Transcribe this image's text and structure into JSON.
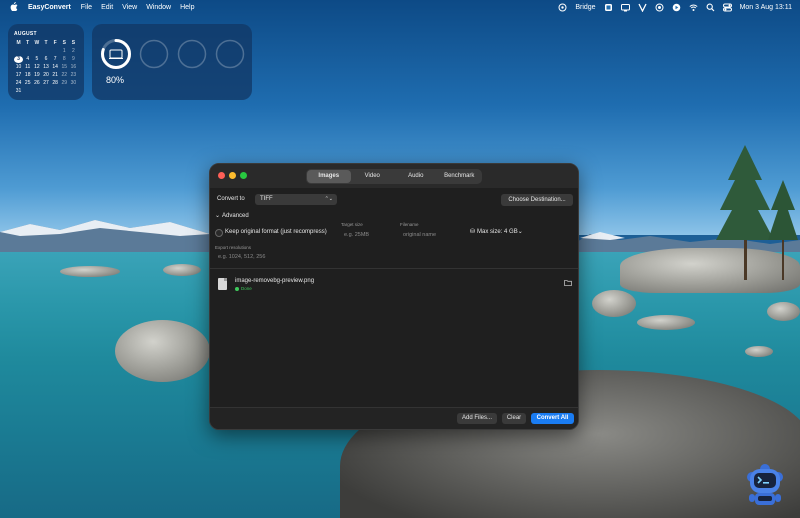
{
  "menubar": {
    "app_name": "EasyConvert",
    "menus": [
      "File",
      "Edit",
      "View",
      "Window",
      "Help"
    ],
    "status_app": "Bridge",
    "clock": "Mon 3 Aug  13:11"
  },
  "calendar": {
    "month": "AUGUST",
    "weekdays": [
      "M",
      "T",
      "W",
      "T",
      "F",
      "S",
      "S"
    ],
    "days": [
      "",
      "",
      "",
      "",
      "",
      "1",
      "2",
      "3",
      "4",
      "5",
      "6",
      "7",
      "8",
      "9",
      "10",
      "11",
      "12",
      "13",
      "14",
      "15",
      "16",
      "17",
      "18",
      "19",
      "20",
      "21",
      "22",
      "23",
      "24",
      "25",
      "26",
      "27",
      "28",
      "29",
      "30",
      "31",
      "",
      "",
      "",
      "",
      "",
      ""
    ],
    "today": "3"
  },
  "battery": {
    "percent_label": "80%",
    "level": 0.8
  },
  "window": {
    "tabs": [
      "Images",
      "Video",
      "Audio",
      "Benchmark"
    ],
    "active_tab": "Images",
    "convert_to_label": "Convert to",
    "format_value": "TIFF",
    "choose_destination": "Choose Destination...",
    "advanced_label": "Advanced",
    "keep_original_label": "Keep original format (just recompress)",
    "target_size_label": "Target size",
    "target_size_placeholder": "e.g. 25MB",
    "filename_label": "Filename",
    "filename_placeholder": "original name",
    "max_size_label": "Max size: 4 GB",
    "export_resolutions_label": "Export resolutions",
    "export_resolutions_placeholder": "e.g. 1024, 512, 256",
    "files": [
      {
        "name": "image-removebg-preview.png",
        "status": "Done"
      }
    ],
    "add_files": "Add Files...",
    "clear": "Clear",
    "convert_all": "Convert All"
  },
  "colors": {
    "accent": "#1a7cf2",
    "status_done": "#3ec95c",
    "window_bg": "#1f1f1f"
  }
}
